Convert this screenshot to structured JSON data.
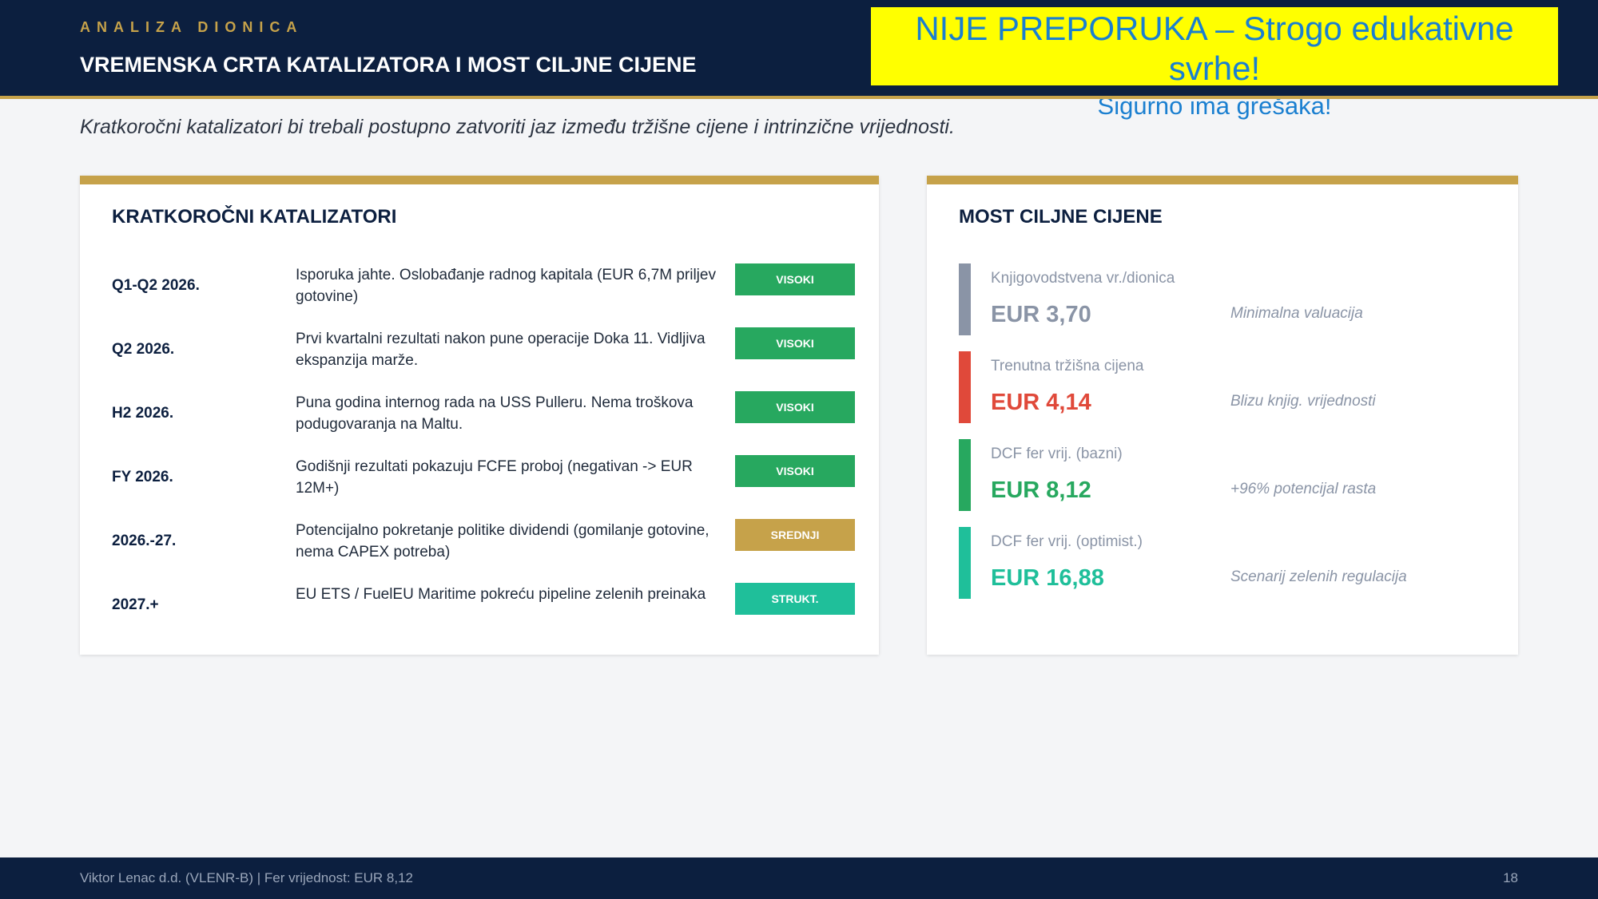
{
  "header": {
    "eyebrow": "ANALIZA DIONICA",
    "title": "VREMENSKA CRTA KATALIZATORA I MOST CILJNE CIJENE"
  },
  "warning": {
    "line1": "NIJE PREPORUKA – Strogo edukativne svrhe!",
    "line2": "Sigurno ima grešaka!"
  },
  "subtitle": "Kratkoročni katalizatori bi trebali postupno zatvoriti jaz između tržišne cijene i intrinzične vrijednosti.",
  "catalysts": {
    "title": "KRATKOROČNI KATALIZATORI",
    "rows": [
      {
        "date": "Q1-Q2 2026.",
        "desc": "Isporuka jahte. Oslobađanje radnog kapitala (EUR 6,7M priljev gotovine)",
        "badge": "VISOKI",
        "color": "#27a85f"
      },
      {
        "date": "Q2 2026.",
        "desc": "Prvi kvartalni rezultati nakon pune operacije Doka 11. Vidljiva ekspanzija marže.",
        "badge": "VISOKI",
        "color": "#27a85f"
      },
      {
        "date": "H2 2026.",
        "desc": "Puna godina internog rada na USS Pulleru. Nema troškova podugovaranja na Maltu.",
        "badge": "VISOKI",
        "color": "#27a85f"
      },
      {
        "date": "FY 2026.",
        "desc": "Godišnji rezultati pokazuju FCFE proboj (negativan -> EUR 12M+)",
        "badge": "VISOKI",
        "color": "#27a85f"
      },
      {
        "date": "2026.-27.",
        "desc": "Potencijalno pokretanje politike dividendi (gomilanje gotovine, nema CAPEX potreba)",
        "badge": "SREDNJI",
        "color": "#c6a24a"
      },
      {
        "date": "2027.+",
        "desc": "EU ETS / FuelEU Maritime pokreću pipeline zelenih preinaka",
        "badge": "STRUKT.",
        "color": "#1fbf9a"
      }
    ]
  },
  "target_price": {
    "title": "MOST CILJNE CIJENE",
    "rows": [
      {
        "label": "Knjigovodstvena vr./dionica",
        "value": "EUR 3,70",
        "note": "Minimalna valuacija",
        "color": "#8a94a6"
      },
      {
        "label": "Trenutna tržišna cijena",
        "value": "EUR 4,14",
        "note": "Blizu knjig. vrijednosti",
        "color": "#e0493a"
      },
      {
        "label": "DCF fer vrij. (bazni)",
        "value": "EUR 8,12",
        "note": "+96% potencijal rasta",
        "color": "#27a85f"
      },
      {
        "label": "DCF fer vrij. (optimist.)",
        "value": "EUR 16,88",
        "note": "Scenarij zelenih regulacija",
        "color": "#1fbf9a"
      }
    ]
  },
  "footer": {
    "left": "Viktor Lenac d.d. (VLENR-B)  |  Fer vrijednost: EUR 8,12",
    "page": "18"
  }
}
